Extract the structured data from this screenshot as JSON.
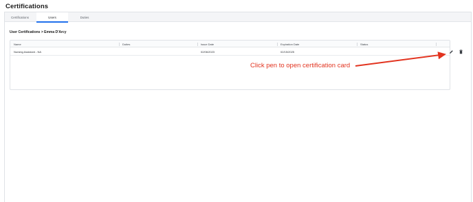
{
  "page": {
    "title": "Certifications"
  },
  "tabs": [
    {
      "label": "Certifications"
    },
    {
      "label": "Users"
    },
    {
      "label": "Duties"
    }
  ],
  "section": {
    "title": "User Certifications > Emma D'Arcy"
  },
  "table": {
    "columns": [
      "Name",
      "Duties",
      "Issue Date",
      "Expiration Date",
      "Status"
    ],
    "rows": [
      {
        "name": "Nursing Assistant - NA",
        "duties": "",
        "issue_date": "02/06/2023",
        "expiration_date": "02/15/2025",
        "status": ""
      }
    ]
  },
  "icons": {
    "edit": "pencil-icon",
    "delete": "trash-icon"
  },
  "annotation": {
    "text": "Click pen to open certification card",
    "color": "#e2331f"
  },
  "colors": {
    "accent": "#1f6feb",
    "annotation": "#e2331f"
  }
}
